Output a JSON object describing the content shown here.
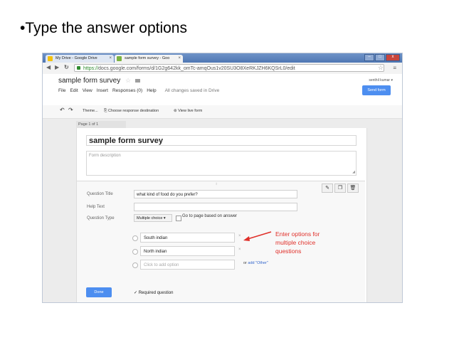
{
  "slide": {
    "title": "•Type the answer options"
  },
  "browser": {
    "tabs": [
      {
        "label": "My Drive - Google Drive",
        "close": "×"
      },
      {
        "label": "sample form survey - Goo",
        "close": "×"
      }
    ],
    "window_buttons": [
      "–",
      "□",
      "x"
    ],
    "url_scheme": "https://",
    "url_rest": "docs.google.com/forms/d/1G2g642kk_omTc-amqOus1v20SU3O8XeRKJZH6KQSrL0/edit"
  },
  "docs": {
    "title": "sample form survey",
    "star": "☆",
    "menu": [
      "File",
      "Edit",
      "View",
      "Insert",
      "Responses (0)",
      "Help"
    ],
    "saved_status": "All changes saved in Drive",
    "user": "senthil kumar ▾",
    "send_label": "Send form"
  },
  "form_toolbar": {
    "undo": "↶",
    "redo": "↷",
    "theme": "Theme...",
    "choose_dest": "Choose response destination",
    "view_live": "View live form"
  },
  "form": {
    "page_label": "Page 1 of 1",
    "title": "sample form survey",
    "description_placeholder": "Form description",
    "question": {
      "handle": "::::",
      "title_label": "Question Title",
      "title_value": "what kind of food do you prefer?",
      "help_label": "Help Text",
      "help_value": "",
      "type_label": "Question Type",
      "type_value": "Multiple choice ▾",
      "goto_label": "Go to page based on answer",
      "options": [
        {
          "value": "South indian",
          "remove": "×"
        },
        {
          "value": "North indian",
          "remove": "×"
        }
      ],
      "add_option_placeholder": "Click to add option",
      "or_label": "or",
      "add_other_label": "add \"Other\"",
      "done_label": "Done",
      "required_label": "Required question",
      "required_checked": "✓"
    }
  },
  "annotation": {
    "lines": [
      "Enter options for",
      "multiple choice",
      "questions"
    ],
    "color": "#e0302a"
  },
  "colors": {
    "accent": "#4d8ef0",
    "chrome": "#4f77b3"
  }
}
